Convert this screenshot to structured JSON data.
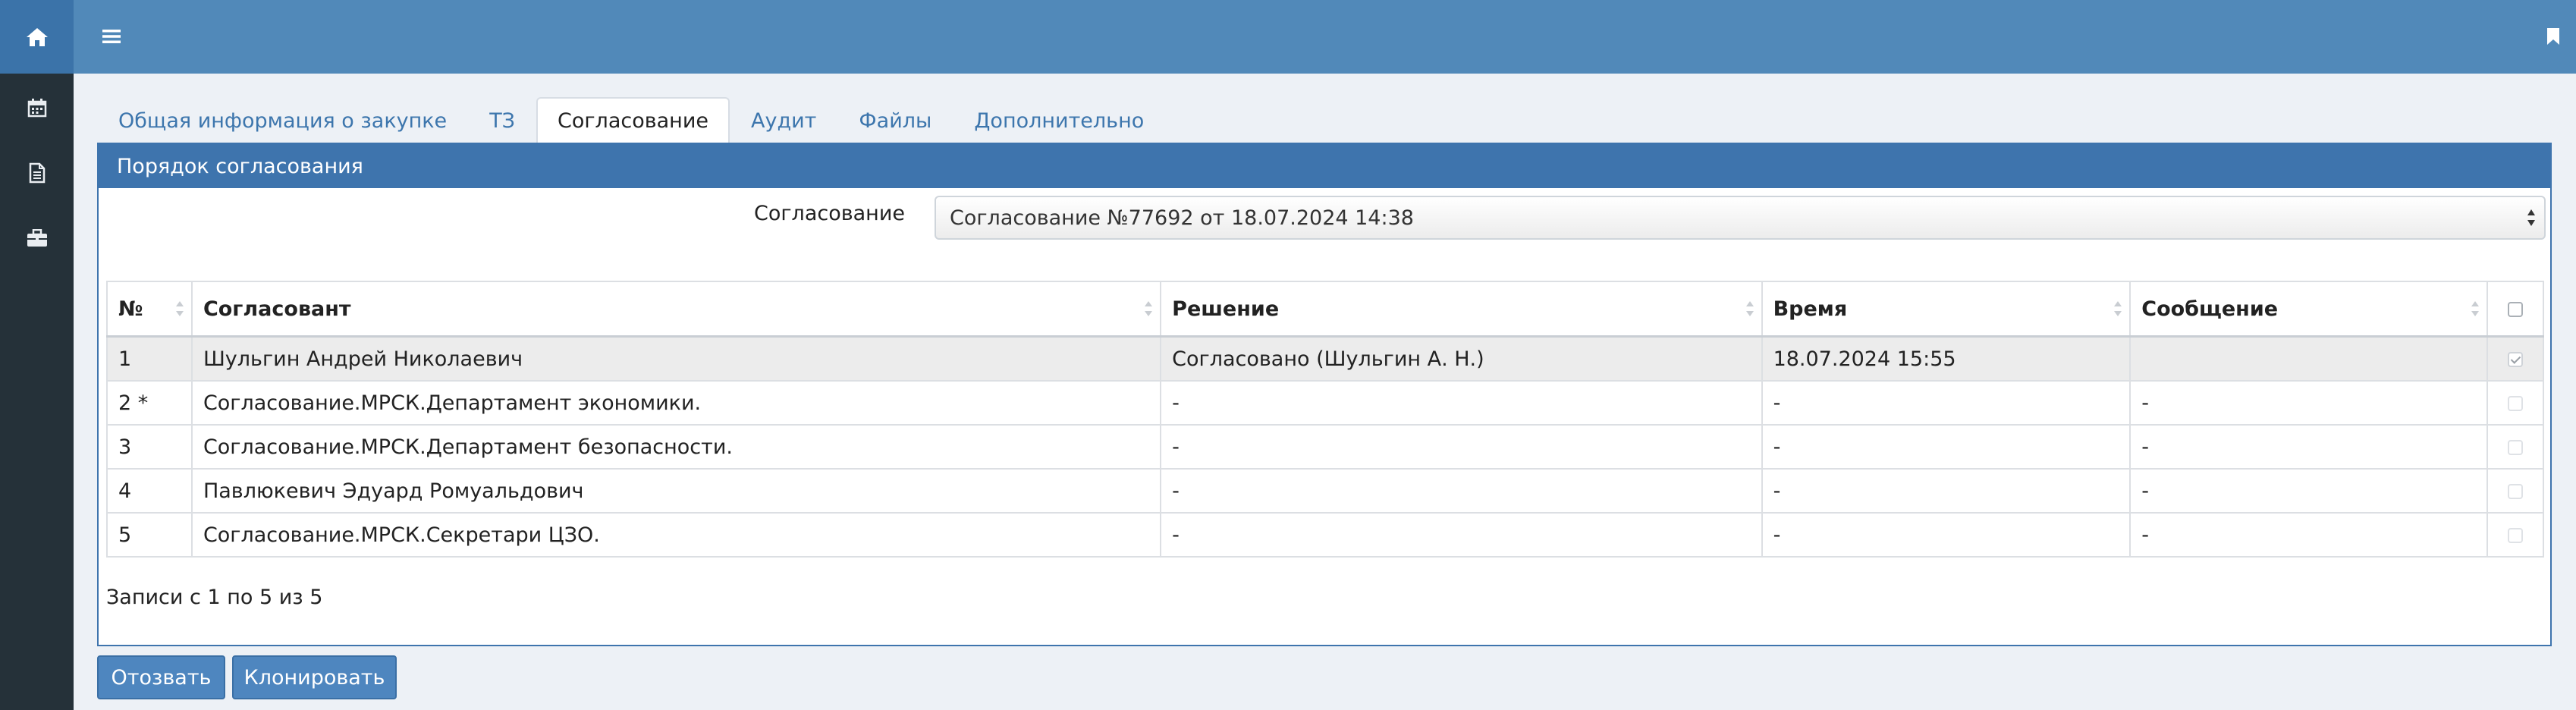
{
  "sidebar": {
    "items": [
      {
        "icon": "home-icon"
      },
      {
        "icon": "calendar-icon"
      },
      {
        "icon": "document-icon"
      },
      {
        "icon": "briefcase-icon"
      }
    ]
  },
  "topbar": {
    "menu_icon": "hamburger-menu-icon",
    "bookmark_icon": "bookmark-icon"
  },
  "tabs": [
    {
      "label": "Общая информация о закупке",
      "active": false
    },
    {
      "label": "ТЗ",
      "active": false
    },
    {
      "label": "Согласование",
      "active": true
    },
    {
      "label": "Аудит",
      "active": false
    },
    {
      "label": "Файлы",
      "active": false
    },
    {
      "label": "Дополнительно",
      "active": false
    }
  ],
  "panel": {
    "title": "Порядок согласования",
    "field_label": "Согласование",
    "select_value": "Согласование №77692 от 18.07.2024 14:38"
  },
  "table": {
    "headers": {
      "num": "№",
      "approver": "Согласовант",
      "decision": "Решение",
      "time": "Время",
      "message": "Сообщение"
    },
    "rows": [
      {
        "num": "1",
        "approver": "Шульгин Андрей Николаевич",
        "decision": "Согласовано (Шульгин А. Н.)",
        "time": "18.07.2024 15:55",
        "message": "",
        "checked": true
      },
      {
        "num": "2 *",
        "approver": "Согласование.МРСК.Департамент экономики.",
        "decision": "-",
        "time": "-",
        "message": "-",
        "checked": false
      },
      {
        "num": "3",
        "approver": "Согласование.МРСК.Департамент безопасности.",
        "decision": "-",
        "time": "-",
        "message": "-",
        "checked": false
      },
      {
        "num": "4",
        "approver": "Павлюкевич Эдуард Ромуальдович",
        "decision": "-",
        "time": "-",
        "message": "-",
        "checked": false
      },
      {
        "num": "5",
        "approver": "Согласование.МРСК.Секретари ЦЗО.",
        "decision": "-",
        "time": "-",
        "message": "-",
        "checked": false
      }
    ],
    "info": "Записи с 1 по 5 из 5"
  },
  "buttons": {
    "revoke": "Отозвать",
    "clone": "Клонировать"
  },
  "colors": {
    "accent": "#3e74ad",
    "topbar": "#5189b9",
    "sidebar": "#253139"
  }
}
